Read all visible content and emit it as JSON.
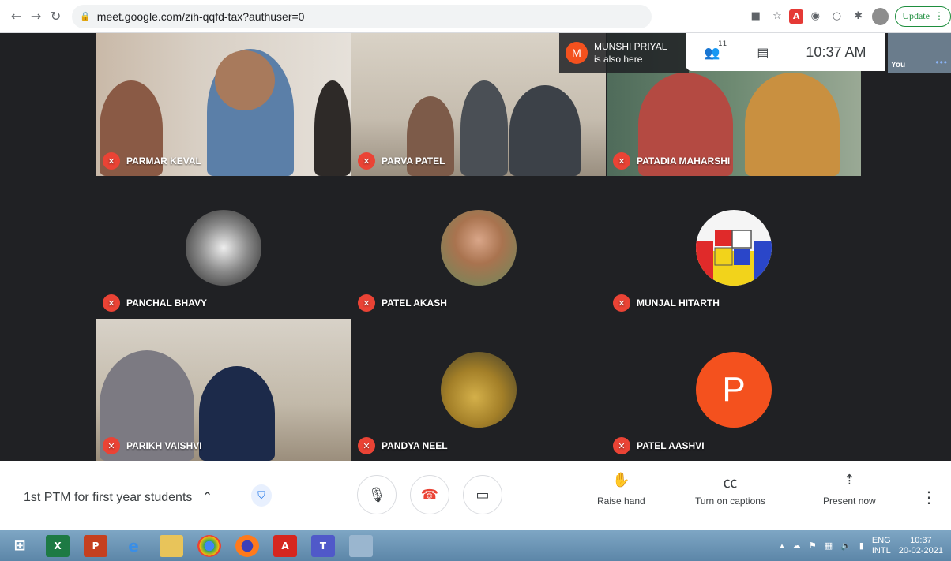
{
  "browser": {
    "url": "meet.google.com/zih-qqfd-tax?authuser=0",
    "update_label": "Update"
  },
  "notification": {
    "initial": "M",
    "name": "MUNSHI PRIYAL",
    "text": "is also here"
  },
  "topbar": {
    "participant_count": "11",
    "time": "10:37 AM",
    "self_label": "You"
  },
  "participants": [
    {
      "name": "PARMAR KEVAL"
    },
    {
      "name": "PARVA PATEL"
    },
    {
      "name": "PATADIA MAHARSHI"
    },
    {
      "name": "PANCHAL BHAVY"
    },
    {
      "name": "PATEL AKASH"
    },
    {
      "name": "MUNJAL HITARTH"
    },
    {
      "name": "PARIKH VAISHVI"
    },
    {
      "name": "PANDYA NEEL"
    },
    {
      "name": "PATEL AASHVI",
      "initial": "P"
    }
  ],
  "controls": {
    "meeting_title": "1st PTM for first year students",
    "raise_hand": "Raise hand",
    "captions": "Turn on captions",
    "present": "Present now"
  },
  "taskbar": {
    "lang_top": "ENG",
    "lang_bottom": "INTL",
    "time": "10:37",
    "date": "20-02-2021"
  },
  "colors": {
    "meet_dark": "#202124",
    "mic_off": "#ea4335",
    "avatar_orange": "#f4511e"
  }
}
